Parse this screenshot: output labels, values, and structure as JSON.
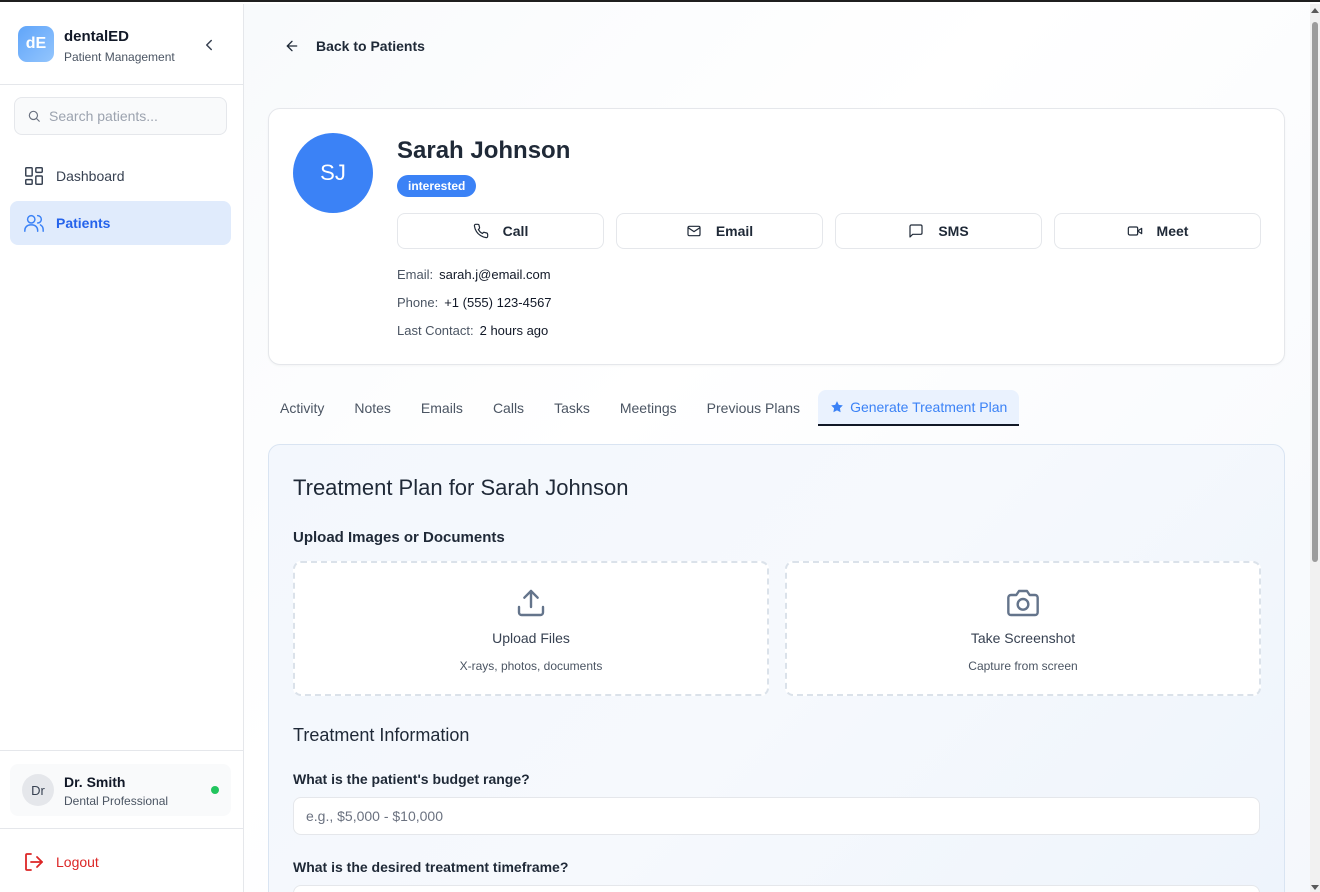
{
  "brand": {
    "logo": "dE",
    "name": "dentalED",
    "subtitle": "Patient Management"
  },
  "search": {
    "placeholder": "Search patients..."
  },
  "nav": [
    {
      "label": "Dashboard",
      "icon": "dashboard-icon"
    },
    {
      "label": "Patients",
      "icon": "users-icon",
      "active": true
    }
  ],
  "user": {
    "initials": "Dr",
    "name": "Dr. Smith",
    "role": "Dental Professional",
    "status_color": "#22c55e"
  },
  "logout": {
    "label": "Logout"
  },
  "back": {
    "label": "Back to Patients"
  },
  "patient": {
    "initials": "SJ",
    "name": "Sarah Johnson",
    "status": "interested",
    "email_label": "Email:",
    "email": "sarah.j@email.com",
    "phone_label": "Phone:",
    "phone": "+1 (555) 123-4567",
    "last_contact_label": "Last Contact:",
    "last_contact": "2 hours ago"
  },
  "actions": {
    "call": "Call",
    "email": "Email",
    "sms": "SMS",
    "meet": "Meet"
  },
  "tabs": {
    "activity": "Activity",
    "notes": "Notes",
    "emails": "Emails",
    "calls": "Calls",
    "tasks": "Tasks",
    "meetings": "Meetings",
    "previous_plans": "Previous Plans",
    "generate": "Generate Treatment Plan"
  },
  "plan": {
    "title": "Treatment Plan for Sarah Johnson",
    "upload_heading": "Upload Images or Documents",
    "upload": {
      "title": "Upload Files",
      "subtitle": "X-rays, photos, documents"
    },
    "screenshot": {
      "title": "Take Screenshot",
      "subtitle": "Capture from screen"
    },
    "info_heading": "Treatment Information",
    "budget_question": "What is the patient's budget range?",
    "budget_placeholder": "e.g., $5,000 - $10,000",
    "timeframe_question": "What is the desired treatment timeframe?"
  },
  "colors": {
    "accent": "#3b82f6",
    "danger": "#dc2626",
    "online": "#22c55e"
  }
}
